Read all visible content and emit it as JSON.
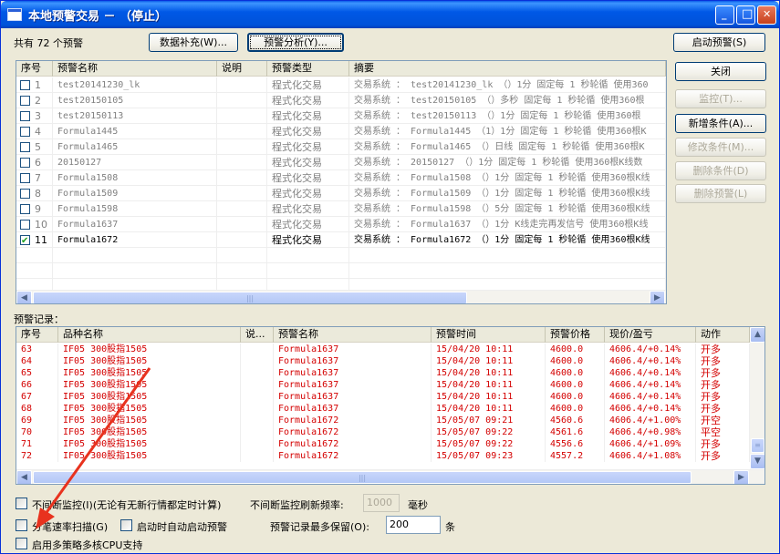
{
  "window": {
    "title": "本地预警交易 － （停止）",
    "accent": "#0058e6",
    "minimize_glyph": "_",
    "maximize_glyph": "□",
    "close_glyph": "✕"
  },
  "toolbar": {
    "count_label": "共有 72 个预警",
    "supplement_btn": "数据补充(W)...",
    "analysis_btn": "预警分析(Y)...",
    "start_btn": "启动预警(S)"
  },
  "side_buttons": {
    "close": "关闭",
    "monitor": "监控(T)...",
    "add_condition": "新增条件(A)...",
    "edit_condition": "修改条件(M)...",
    "delete_condition": "删除条件(D)",
    "delete_alert": "删除预警(L)"
  },
  "alerts_table": {
    "headers": [
      "序号",
      "预警名称",
      "说明",
      "预警类型",
      "摘要"
    ],
    "rows": [
      {
        "n": "1",
        "name": "test20141230_lk",
        "type": "程式化交易",
        "summary": "交易系统 ： test20141230_lk （）1分 固定每 1 秒轮循 使用360",
        "checked": false,
        "active": false
      },
      {
        "n": "2",
        "name": "test20150105",
        "type": "程式化交易",
        "summary": "交易系统 ： test20150105 （）多秒 固定每 1 秒轮循 使用360根",
        "checked": false,
        "active": false
      },
      {
        "n": "3",
        "name": "test20150113",
        "type": "程式化交易",
        "summary": "交易系统 ： test20150113 （）1分 固定每 1 秒轮循 使用360根",
        "checked": false,
        "active": false
      },
      {
        "n": "4",
        "name": "Formula1445",
        "type": "程式化交易",
        "summary": "交易系统 ： Formula1445 （1）1分 固定每 1 秒轮循 使用360根K",
        "checked": false,
        "active": false
      },
      {
        "n": "5",
        "name": "Formula1465",
        "type": "程式化交易",
        "summary": "交易系统 ： Formula1465 （）日线 固定每 1 秒轮循 使用360根K",
        "checked": false,
        "active": false
      },
      {
        "n": "6",
        "name": "20150127",
        "type": "程式化交易",
        "summary": "交易系统 ： 20150127 （）1分 固定每 1 秒轮循 使用360根K线数",
        "checked": false,
        "active": false
      },
      {
        "n": "7",
        "name": "Formula1508",
        "type": "程式化交易",
        "summary": "交易系统 ： Formula1508 （）1分 固定每 1 秒轮循 使用360根K线",
        "checked": false,
        "active": false
      },
      {
        "n": "8",
        "name": "Formula1509",
        "type": "程式化交易",
        "summary": "交易系统 ： Formula1509 （）1分 固定每 1 秒轮循 使用360根K线",
        "checked": false,
        "active": false
      },
      {
        "n": "9",
        "name": "Formula1598",
        "type": "程式化交易",
        "summary": "交易系统 ： Formula1598 （）5分 固定每 1 秒轮循 使用360根K线",
        "checked": false,
        "active": false
      },
      {
        "n": "10",
        "name": "Formula1637",
        "type": "程式化交易",
        "summary": "交易系统 ： Formula1637 （）1分 K线走完再发信号 使用360根K线",
        "checked": false,
        "active": false
      },
      {
        "n": "11",
        "name": "Formula1672",
        "type": "程式化交易",
        "summary": "交易系统 ： Formula1672 （）1分 固定每 1 秒轮循 使用360根K线",
        "checked": true,
        "active": true
      }
    ]
  },
  "records_label": "预警记录：",
  "records_table": {
    "headers": [
      "序号",
      "品种名称",
      "说...",
      "预警名称",
      "预警时间",
      "预警价格",
      "现价/盈亏",
      "动作"
    ],
    "rows": [
      {
        "n": "63",
        "product": "IF05 300股指1505",
        "alert": "Formula1637",
        "time": "15/04/20 10:11",
        "price": "4600.0",
        "pnl": "4606.4/+0.14%",
        "action": "开多"
      },
      {
        "n": "64",
        "product": "IF05 300股指1505",
        "alert": "Formula1637",
        "time": "15/04/20 10:11",
        "price": "4600.0",
        "pnl": "4606.4/+0.14%",
        "action": "开多"
      },
      {
        "n": "65",
        "product": "IF05 300股指1505",
        "alert": "Formula1637",
        "time": "15/04/20 10:11",
        "price": "4600.0",
        "pnl": "4606.4/+0.14%",
        "action": "开多"
      },
      {
        "n": "66",
        "product": "IF05 300股指1505",
        "alert": "Formula1637",
        "time": "15/04/20 10:11",
        "price": "4600.0",
        "pnl": "4606.4/+0.14%",
        "action": "开多"
      },
      {
        "n": "67",
        "product": "IF05 300股指1505",
        "alert": "Formula1637",
        "time": "15/04/20 10:11",
        "price": "4600.0",
        "pnl": "4606.4/+0.14%",
        "action": "开多"
      },
      {
        "n": "68",
        "product": "IF05 300股指1505",
        "alert": "Formula1637",
        "time": "15/04/20 10:11",
        "price": "4600.0",
        "pnl": "4606.4/+0.14%",
        "action": "开多"
      },
      {
        "n": "69",
        "product": "IF05 300股指1505",
        "alert": "Formula1672",
        "time": "15/05/07 09:21",
        "price": "4560.6",
        "pnl": "4606.4/+1.00%",
        "action": "开空"
      },
      {
        "n": "70",
        "product": "IF05 300股指1505",
        "alert": "Formula1672",
        "time": "15/05/07 09:22",
        "price": "4561.6",
        "pnl": "4606.4/+0.98%",
        "action": "平空"
      },
      {
        "n": "71",
        "product": "IF05 300股指1505",
        "alert": "Formula1672",
        "time": "15/05/07 09:22",
        "price": "4556.6",
        "pnl": "4606.4/+1.09%",
        "action": "开多"
      },
      {
        "n": "72",
        "product": "IF05 300股指1505",
        "alert": "Formula1672",
        "time": "15/05/07 09:23",
        "price": "4557.2",
        "pnl": "4606.4/+1.08%",
        "action": "开多"
      }
    ]
  },
  "options": {
    "continuous_monitor": "不间断监控(I)(无论有无新行情都定时计算)",
    "refresh_rate_label": "不间断监控刷新频率:",
    "refresh_rate_value": "1000",
    "refresh_unit": "毫秒",
    "tick_scan": "分笔速率扫描(G)",
    "auto_start": "启动时自动启动预警",
    "max_records_label": "预警记录最多保留(O):",
    "max_records_value": "200",
    "max_records_unit": "条",
    "multicore": "启用多策略多核CPU支持"
  },
  "annotation_color": "#e8321e"
}
